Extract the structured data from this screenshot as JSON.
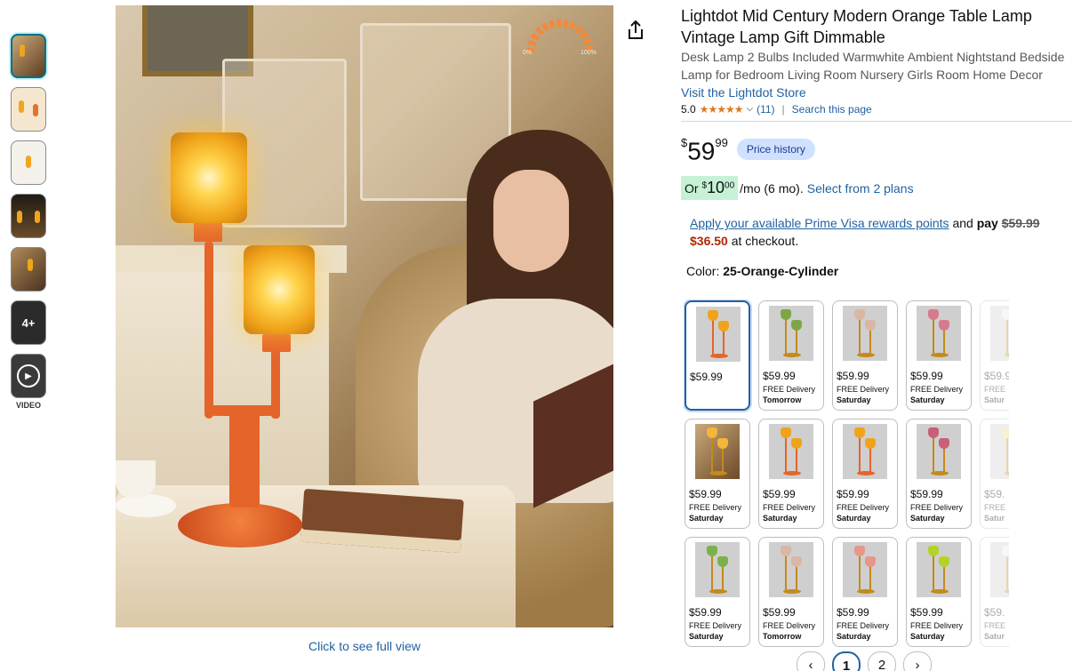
{
  "product": {
    "title": "Lightdot Mid Century Modern Orange Table Lamp Vintage Lamp Gift Dimmable",
    "subtitle": "Desk Lamp 2 Bulbs Included Warmwhite Ambient Nightstand Bedside Lamp for Bedroom Living Room Nursery Girls Room Home Decor",
    "store_link": "Visit the Lightdot Store",
    "rating": "5.0",
    "review_count": "(11)",
    "search_page": "Search this page"
  },
  "price": {
    "currency": "$",
    "whole": "59",
    "fraction": "99",
    "history_label": "Price history"
  },
  "monthly": {
    "or": "Or",
    "currency": "$",
    "whole": "10",
    "fraction": "00",
    "term": "/mo (6 mo).",
    "plans_link": "Select from 2 plans"
  },
  "prime": {
    "link": "Apply your available Prime Visa rewards points",
    "and_pay": "and",
    "pay": "pay",
    "old_price": "$59.99",
    "new_price": "$36.50",
    "suffix": "at checkout."
  },
  "color": {
    "label": "Color:",
    "value": "25-Orange-Cylinder"
  },
  "image": {
    "full_view": "Click to see full view",
    "dimmer_min": "0%",
    "dimmer_max": "100%"
  },
  "thumbnails": {
    "more_label": "4+",
    "video_label": "VIDEO"
  },
  "swatches": [
    {
      "price": "$59.99",
      "delivery": "",
      "day": "",
      "shade": "#f0a31a",
      "pole": "#e5642a",
      "selected": true
    },
    {
      "price": "$59.99",
      "delivery": "FREE Delivery",
      "day": "Tomorrow",
      "shade": "#7ea646",
      "pole": "#c48a1b"
    },
    {
      "price": "$59.99",
      "delivery": "FREE Delivery",
      "day": "Saturday",
      "shade": "#d9b7a4",
      "pole": "#c48a1b"
    },
    {
      "price": "$59.99",
      "delivery": "FREE Delivery",
      "day": "Saturday",
      "shade": "#d77a8d",
      "pole": "#c48a1b"
    },
    {
      "price": "$59.9",
      "delivery": "FREE",
      "day": "Satur",
      "shade": "#eaeaea",
      "pole": "#c48a1b",
      "faded": true
    },
    {
      "price": "$59.99",
      "delivery": "FREE Delivery",
      "day": "Saturday",
      "shade": "#f3b53a",
      "pole": "#c48a1b",
      "photo": true
    },
    {
      "price": "$59.99",
      "delivery": "FREE Delivery",
      "day": "Saturday",
      "shade": "#f0a31a",
      "pole": "#e5642a"
    },
    {
      "price": "$59.99",
      "delivery": "FREE Delivery",
      "day": "Saturday",
      "shade": "#f0a31a",
      "pole": "#e5642a"
    },
    {
      "price": "$59.99",
      "delivery": "FREE Delivery",
      "day": "Saturday",
      "shade": "#c8607a",
      "pole": "#c48a1b"
    },
    {
      "price": "$59.",
      "delivery": "FREE",
      "day": "Satur",
      "shade": "#f3d77a",
      "pole": "#c48a1b",
      "faded": true
    },
    {
      "price": "$59.99",
      "delivery": "FREE Delivery",
      "day": "Saturday",
      "shade": "#7bb04a",
      "pole": "#c48a1b"
    },
    {
      "price": "$59.99",
      "delivery": "FREE Delivery",
      "day": "Tomorrow",
      "shade": "#d9b7a4",
      "pole": "#c48a1b"
    },
    {
      "price": "$59.99",
      "delivery": "FREE Delivery",
      "day": "Saturday",
      "shade": "#e6968a",
      "pole": "#c48a1b"
    },
    {
      "price": "$59.99",
      "delivery": "FREE Delivery",
      "day": "Saturday",
      "shade": "#b5d22a",
      "pole": "#c48a1b"
    },
    {
      "price": "$59.",
      "delivery": "FREE",
      "day": "Satur",
      "shade": "#eaeaea",
      "pole": "#c48a1b",
      "faded": true
    }
  ],
  "pager": {
    "prev": "‹",
    "pages": [
      "1",
      "2"
    ],
    "next": "›",
    "active": "1"
  },
  "colors": {
    "link": "#2162a1",
    "star": "#de7921",
    "deal_red": "#b12704",
    "price_history_bg": "#cfe1ff",
    "monthly_bg": "#c6f1d5"
  }
}
